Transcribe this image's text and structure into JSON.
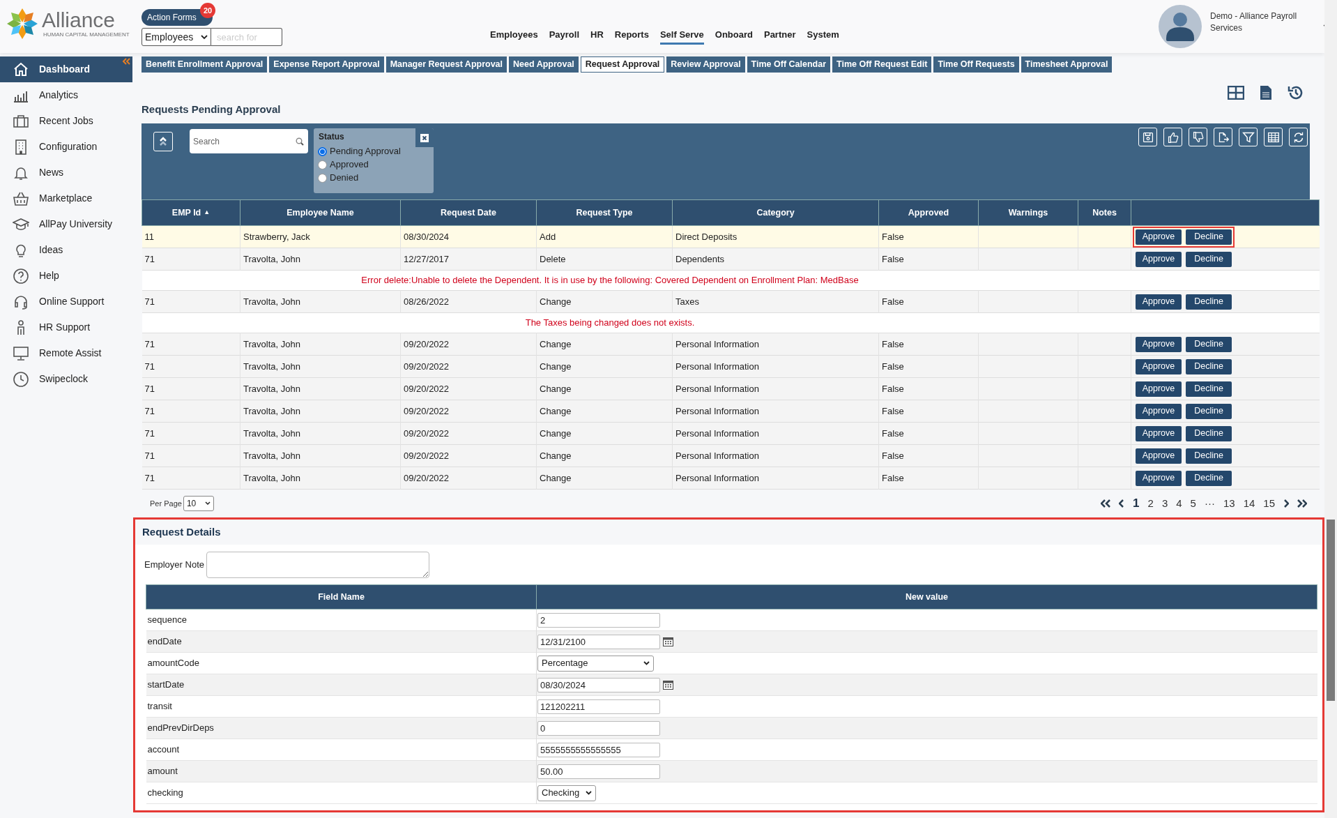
{
  "header": {
    "logo": {
      "name": "Alliance",
      "tagline": "HUMAN CAPITAL MANAGEMENT"
    },
    "action_forms": {
      "label": "Action Forms",
      "badge": "20"
    },
    "search_scope": {
      "value": "Employees"
    },
    "search": {
      "placeholder": "search for"
    },
    "nav": [
      {
        "label": "Employees",
        "selected": false
      },
      {
        "label": "Payroll",
        "selected": false
      },
      {
        "label": "HR",
        "selected": false
      },
      {
        "label": "Reports",
        "selected": false
      },
      {
        "label": "Self Serve",
        "selected": true
      },
      {
        "label": "Onboard",
        "selected": false
      },
      {
        "label": "Partner",
        "selected": false
      },
      {
        "label": "System",
        "selected": false
      }
    ],
    "user": {
      "name": "Demo - Alliance Payroll Services"
    }
  },
  "sidebar": {
    "items": [
      {
        "label": "Dashboard",
        "selected": true
      },
      {
        "label": "Analytics",
        "selected": false
      },
      {
        "label": "Recent Jobs",
        "selected": false
      },
      {
        "label": "Configuration",
        "selected": false
      },
      {
        "label": "News",
        "selected": false
      },
      {
        "label": "Marketplace",
        "selected": false
      },
      {
        "label": "AllPay University",
        "selected": false
      },
      {
        "label": "Ideas",
        "selected": false
      },
      {
        "label": "Help",
        "selected": false
      },
      {
        "label": "Online Support",
        "selected": false
      },
      {
        "label": "HR Support",
        "selected": false
      },
      {
        "label": "Remote Assist",
        "selected": false
      },
      {
        "label": "Swipeclock",
        "selected": false
      }
    ]
  },
  "tabs": [
    {
      "label": "Benefit Enrollment Approval",
      "selected": false
    },
    {
      "label": "Expense Report Approval",
      "selected": false
    },
    {
      "label": "Manager Request Approval",
      "selected": false
    },
    {
      "label": "Need Approval",
      "selected": false
    },
    {
      "label": "Request Approval",
      "selected": true
    },
    {
      "label": "Review Approval",
      "selected": false
    },
    {
      "label": "Time Off Calendar",
      "selected": false
    },
    {
      "label": "Time Off Request Edit",
      "selected": false
    },
    {
      "label": "Time Off Requests",
      "selected": false
    },
    {
      "label": "Timesheet Approval",
      "selected": false
    }
  ],
  "page_title": "Requests Pending Approval",
  "filters": {
    "search": {
      "placeholder": "Search"
    },
    "status": {
      "title": "Status",
      "options": [
        {
          "label": "Pending Approval",
          "selected": true
        },
        {
          "label": "Approved",
          "selected": false
        },
        {
          "label": "Denied",
          "selected": false
        }
      ]
    }
  },
  "table": {
    "columns": [
      {
        "label": "EMP Id",
        "sort": "▲"
      },
      {
        "label": "Employee Name"
      },
      {
        "label": "Request Date"
      },
      {
        "label": "Request Type"
      },
      {
        "label": "Category"
      },
      {
        "label": "Approved"
      },
      {
        "label": "Warnings"
      },
      {
        "label": "Notes"
      }
    ],
    "rows": [
      {
        "kind": "request",
        "selected": true,
        "highlighted": true,
        "cells": [
          "11",
          "Strawberry, Jack",
          "08/30/2024",
          "Add",
          "Direct Deposits",
          "False",
          "",
          ""
        ],
        "actions": [
          "Approve",
          "Decline"
        ]
      },
      {
        "kind": "request",
        "selected": false,
        "highlighted": false,
        "cells": [
          "71",
          "Travolta, John",
          "12/27/2017",
          "Delete",
          "Dependents",
          "False",
          "",
          ""
        ],
        "actions": [
          "Approve",
          "Decline"
        ]
      },
      {
        "kind": "error",
        "message": "Error delete:Unable to delete the Dependent. It is in use by the following: Covered Dependent on Enrollment Plan: MedBase"
      },
      {
        "kind": "request",
        "selected": false,
        "highlighted": false,
        "cells": [
          "71",
          "Travolta, John",
          "08/26/2022",
          "Change",
          "Taxes",
          "False",
          "",
          ""
        ],
        "actions": [
          "Approve",
          "Decline"
        ]
      },
      {
        "kind": "error",
        "message": "The Taxes being changed does not exists."
      },
      {
        "kind": "request",
        "selected": false,
        "highlighted": false,
        "cells": [
          "71",
          "Travolta, John",
          "09/20/2022",
          "Change",
          "Personal Information",
          "False",
          "",
          ""
        ],
        "actions": [
          "Approve",
          "Decline"
        ]
      },
      {
        "kind": "request",
        "selected": false,
        "highlighted": false,
        "cells": [
          "71",
          "Travolta, John",
          "09/20/2022",
          "Change",
          "Personal Information",
          "False",
          "",
          ""
        ],
        "actions": [
          "Approve",
          "Decline"
        ]
      },
      {
        "kind": "request",
        "selected": false,
        "highlighted": false,
        "cells": [
          "71",
          "Travolta, John",
          "09/20/2022",
          "Change",
          "Personal Information",
          "False",
          "",
          ""
        ],
        "actions": [
          "Approve",
          "Decline"
        ]
      },
      {
        "kind": "request",
        "selected": false,
        "highlighted": false,
        "cells": [
          "71",
          "Travolta, John",
          "09/20/2022",
          "Change",
          "Personal Information",
          "False",
          "",
          ""
        ],
        "actions": [
          "Approve",
          "Decline"
        ]
      },
      {
        "kind": "request",
        "selected": false,
        "highlighted": false,
        "cells": [
          "71",
          "Travolta, John",
          "09/20/2022",
          "Change",
          "Personal Information",
          "False",
          "",
          ""
        ],
        "actions": [
          "Approve",
          "Decline"
        ]
      },
      {
        "kind": "request",
        "selected": false,
        "highlighted": false,
        "cells": [
          "71",
          "Travolta, John",
          "09/20/2022",
          "Change",
          "Personal Information",
          "False",
          "",
          ""
        ],
        "actions": [
          "Approve",
          "Decline"
        ]
      },
      {
        "kind": "request",
        "selected": false,
        "highlighted": false,
        "cells": [
          "71",
          "Travolta, John",
          "09/20/2022",
          "Change",
          "Personal Information",
          "False",
          "",
          ""
        ],
        "actions": [
          "Approve",
          "Decline"
        ]
      }
    ]
  },
  "pagination": {
    "per_page_label": "Per Page",
    "per_page": "10",
    "pages": [
      {
        "label": "1",
        "selected": true
      },
      {
        "label": "2",
        "selected": false
      },
      {
        "label": "3",
        "selected": false
      },
      {
        "label": "4",
        "selected": false
      },
      {
        "label": "5",
        "selected": false
      },
      {
        "label": "···",
        "selected": false
      },
      {
        "label": "13",
        "selected": false
      },
      {
        "label": "14",
        "selected": false
      },
      {
        "label": "15",
        "selected": false
      }
    ]
  },
  "details": {
    "title": "Request Details",
    "highlighted": true,
    "employer_note": {
      "label": "Employer Note"
    },
    "columns": [
      "Field Name",
      "New value"
    ],
    "fields": [
      {
        "name": "sequence",
        "kind": "text",
        "value": "2"
      },
      {
        "name": "endDate",
        "kind": "date",
        "value": "12/31/2100"
      },
      {
        "name": "amountCode",
        "kind": "select",
        "value": "Percentage"
      },
      {
        "name": "startDate",
        "kind": "date",
        "value": "08/30/2024"
      },
      {
        "name": "transit",
        "kind": "text",
        "value": "121202211"
      },
      {
        "name": "endPrevDirDeps",
        "kind": "text",
        "value": "0"
      },
      {
        "name": "account",
        "kind": "text",
        "value": "5555555555555555"
      },
      {
        "name": "amount",
        "kind": "text",
        "value": "50.00"
      },
      {
        "name": "checking",
        "kind": "select",
        "value": "Checking"
      }
    ]
  }
}
